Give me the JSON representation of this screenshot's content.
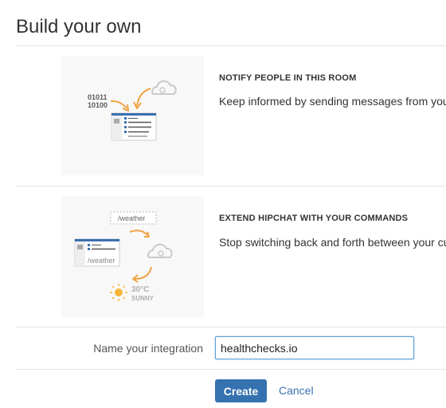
{
  "page": {
    "title": "Build your own"
  },
  "features": [
    {
      "heading": "NOTIFY PEOPLE IN THIS ROOM",
      "description": "Keep informed by sending messages from your",
      "illustration": {
        "icon": "notify-illustration",
        "binary_lines": [
          "01011",
          "10100"
        ]
      }
    },
    {
      "heading": "EXTEND HIPCHAT WITH YOUR COMMANDS",
      "description": "Stop switching back and forth between your cu",
      "illustration": {
        "icon": "commands-illustration",
        "command": "/weather",
        "window_command": "/weather",
        "temperature": "30°C",
        "condition": "SUNNY"
      }
    }
  ],
  "form": {
    "name_label": "Name your integration",
    "name_value": "healthchecks.io",
    "create_label": "Create",
    "cancel_label": "Cancel"
  },
  "colors": {
    "accent_orange": "#f0a344",
    "primary_blue": "#3572b0",
    "link_blue": "#3b73af",
    "window_header_blue": "#3b6fb0"
  }
}
